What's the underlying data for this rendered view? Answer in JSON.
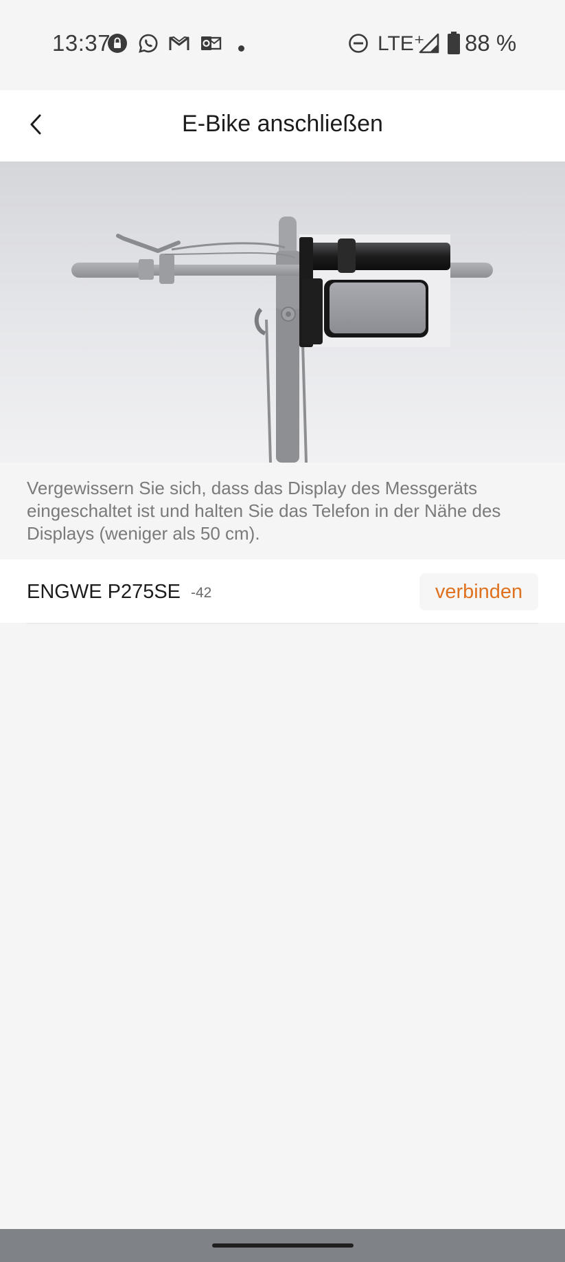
{
  "status_bar": {
    "time": "13:37",
    "network": "LTE⁺",
    "battery": "88 %",
    "icons_left": [
      "vpn-lock-icon",
      "whatsapp-icon",
      "gmail-icon",
      "outlook-icon",
      "dot-icon"
    ],
    "icons_right": [
      "do-not-disturb-icon",
      "signal-icon",
      "battery-icon"
    ]
  },
  "header": {
    "title": "E-Bike anschließen",
    "back_icon": "chevron-left-icon"
  },
  "hero": {
    "image": "ebike-handlebar-display-illustration"
  },
  "instructions": "Vergewissern Sie sich, dass das Display des Messgeräts eingeschaltet ist und halten Sie das Telefon in der Nähe des Displays (weniger als 50 cm).",
  "devices": [
    {
      "name": "ENGWE P275SE",
      "rssi": "-42",
      "action_label": "verbinden"
    }
  ],
  "colors": {
    "accent": "#e0711e",
    "background": "#f5f5f5",
    "surface": "#ffffff",
    "nav_bar": "#7f8286"
  }
}
